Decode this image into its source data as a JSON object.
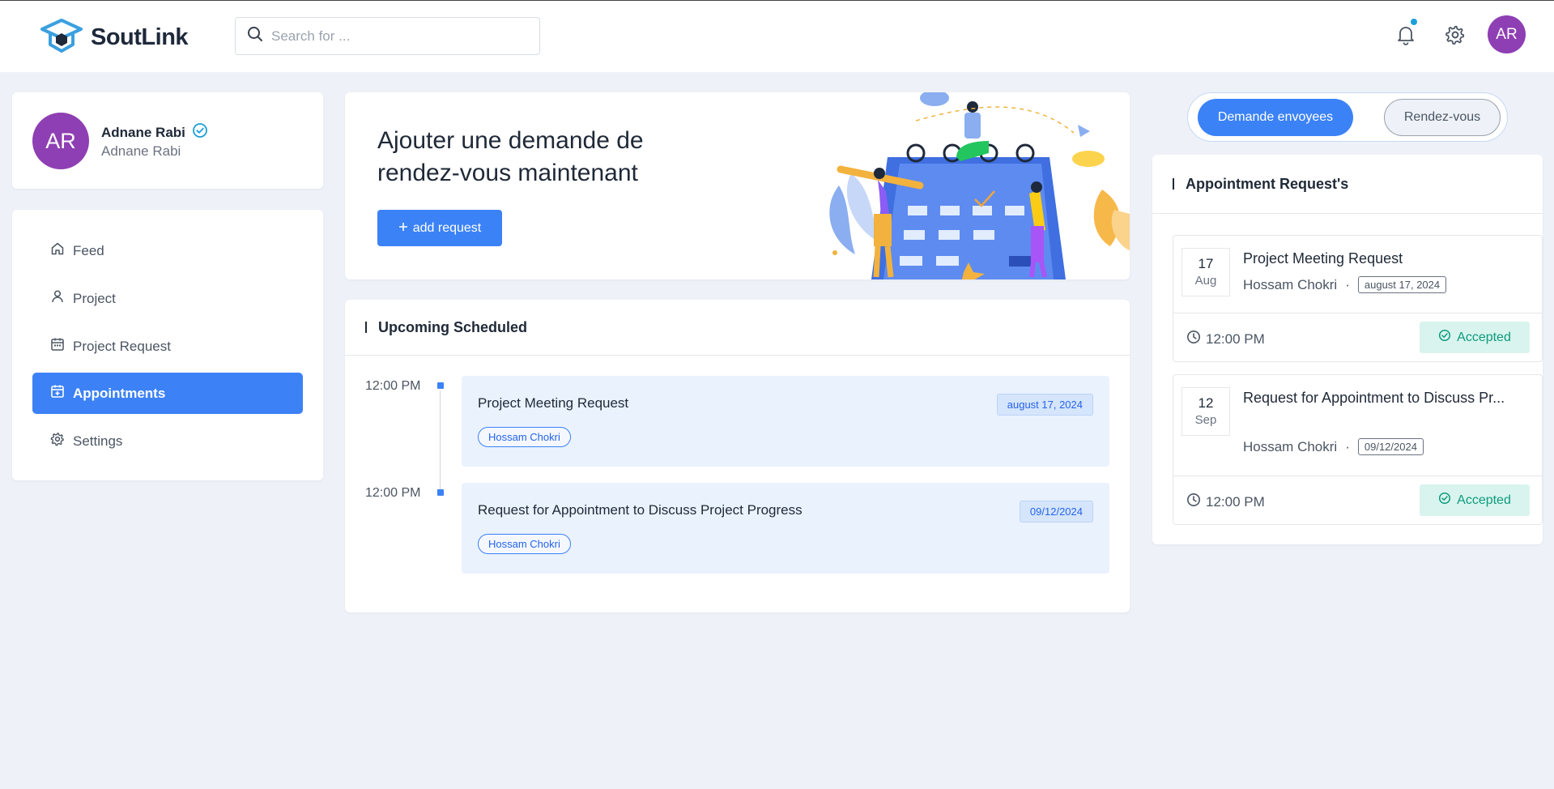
{
  "app": {
    "name": "SoutLink"
  },
  "search": {
    "placeholder": "Search for ..."
  },
  "header": {
    "avatar_initials": "AR"
  },
  "profile": {
    "initials": "AR",
    "name": "Adnane Rabi",
    "subtitle": "Adnane Rabi"
  },
  "sidebar": {
    "items": [
      {
        "label": "Feed",
        "icon": "home-icon"
      },
      {
        "label": "Project",
        "icon": "user-icon"
      },
      {
        "label": "Project Request",
        "icon": "calendar-icon"
      },
      {
        "label": "Appointments",
        "icon": "calendar-plus-icon",
        "active": true
      },
      {
        "label": "Settings",
        "icon": "gear-icon"
      }
    ]
  },
  "hero": {
    "headline": "Ajouter une demande de rendez-vous maintenant",
    "add_label": "add request"
  },
  "upcoming": {
    "title": "Upcoming Scheduled",
    "events": [
      {
        "time": "12:00 PM",
        "title": "Project Meeting Request",
        "date": "august 17, 2024",
        "person": "Hossam Chokri"
      },
      {
        "time": "12:00 PM",
        "title": "Request for Appointment to Discuss Project Progress",
        "date": "09/12/2024",
        "person": "Hossam Chokri"
      }
    ]
  },
  "toggle": {
    "active": "Demande envoyees",
    "inactive": "Rendez-vous"
  },
  "requests": {
    "title": "Appointment Request's",
    "items": [
      {
        "day": "17",
        "month": "Aug",
        "title": "Project Meeting Request",
        "person": "Hossam Chokri",
        "date": "august 17, 2024",
        "time": "12:00 PM",
        "status": "Accepted"
      },
      {
        "day": "12",
        "month": "Sep",
        "title": "Request for Appointment to Discuss Pr...",
        "person": "Hossam Chokri",
        "date": "09/12/2024",
        "time": "12:00 PM",
        "status": "Accepted"
      }
    ]
  },
  "colors": {
    "primary": "#3b82f6",
    "avatar": "#8e3fb3",
    "accepted_bg": "#d9f4ee",
    "accepted_text": "#0d9b7d",
    "page_bg": "#eef2f8"
  }
}
